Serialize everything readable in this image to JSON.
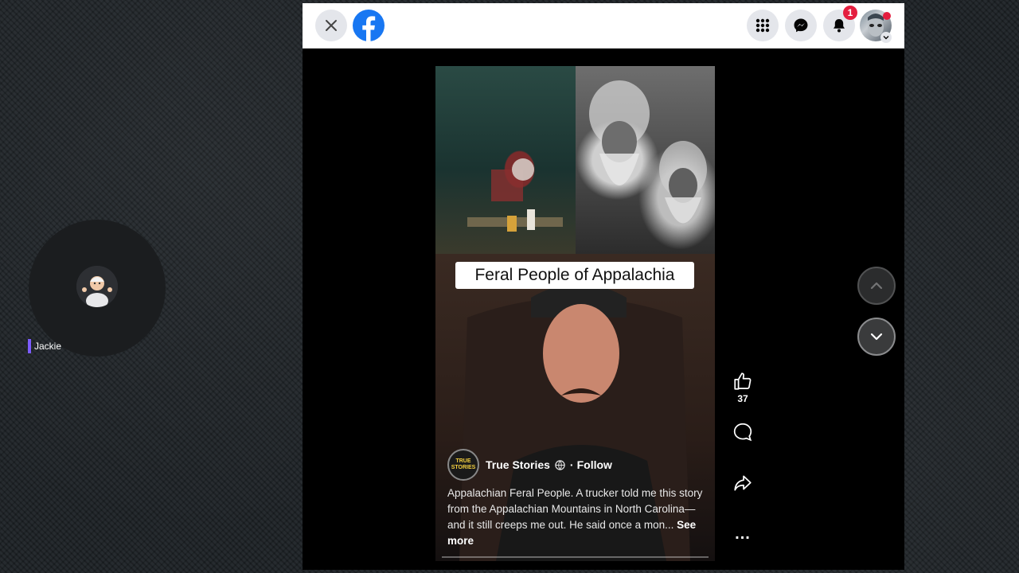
{
  "participant": {
    "name": "Jackie"
  },
  "topbar": {
    "notification_count": "1"
  },
  "video": {
    "title_overlay": "Feral People of Appalachia",
    "author": "True Stories",
    "author_badge": "TRUE\nSTORIES",
    "follow_label": "Follow",
    "separator": "·",
    "description": "Appalachian Feral People. A trucker told me this story from the Appalachian Mountains in North Carolina—and it still creeps me out. He said once a mon...",
    "see_more_label": "See more"
  },
  "actions": {
    "like_count": "37",
    "more_label": "..."
  },
  "colors": {
    "facebook_blue": "#1877f2",
    "badge_red": "#e41e3f",
    "name_tag_accent": "#7c5cff"
  },
  "icons": [
    "close-icon",
    "facebook-logo-icon",
    "menu-grid-icon",
    "messenger-icon",
    "bell-icon",
    "chevron-down-icon",
    "like-icon",
    "comment-icon",
    "share-icon",
    "more-icon",
    "chevron-up-icon",
    "globe-icon"
  ]
}
